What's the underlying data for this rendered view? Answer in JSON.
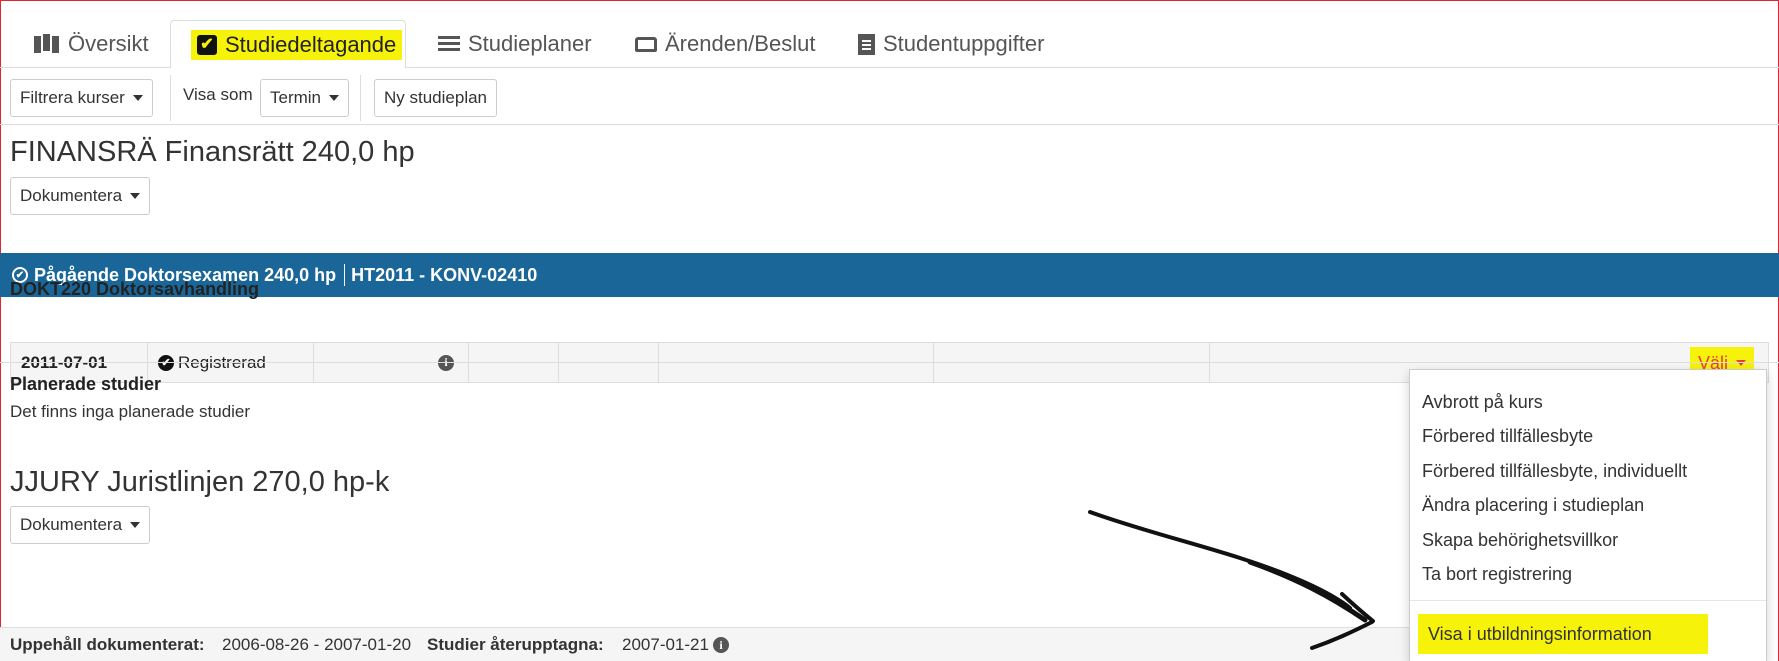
{
  "tabs": [
    {
      "label": "Översikt",
      "icon": "map-icon"
    },
    {
      "label": "Studiedeltagande",
      "icon": "check-square-icon"
    },
    {
      "label": "Studieplaner",
      "icon": "list-icon"
    },
    {
      "label": "Ärenden/Beslut",
      "icon": "inbox-icon"
    },
    {
      "label": "Studentuppgifter",
      "icon": "file-icon"
    }
  ],
  "toolbar": {
    "filter_label": "Filtrera kurser",
    "view_as_label": "Visa som",
    "view_as_value": "Termin",
    "new_plan_label": "Ny studieplan"
  },
  "program1": {
    "title": "FINANSRÄ Finansrätt 240,0 hp",
    "document_button": "Dokumentera",
    "bar_status": "Pågående Doktorsexamen 240,0 hp",
    "bar_term": "HT2011 - KONV-02410",
    "course_title": "DOKT220 Doktorsavhandling",
    "course_row": {
      "date": "2011-07-01",
      "status": "Registrerad",
      "action": "Välj"
    },
    "planned_heading": "Planerade studier",
    "planned_text": "Det finns inga planerade studier"
  },
  "program2": {
    "title": "JJURY Juristlinjen 270,0 hp-k",
    "document_button": "Dokumentera",
    "pause_label": "Uppehåll dokumenterat:",
    "pause_value": "2006-08-26 - 2007-01-20",
    "resume_label": "Studier återupptagna:",
    "resume_value": "2007-01-21"
  },
  "dropdown": {
    "items": [
      "Avbrott på kurs",
      "Förbered tillfällesbyte",
      "Förbered tillfällesbyte, individuellt",
      "Ändra placering i studieplan",
      "Skapa behörighetsvillkor",
      "Ta bort registrering",
      "Visa i utbildningsinformation"
    ]
  },
  "colors": {
    "highlight": "#f7f20a",
    "bar_blue": "#1b6699",
    "valj_red": "#e4413a",
    "frame_red": "#e0282e"
  }
}
